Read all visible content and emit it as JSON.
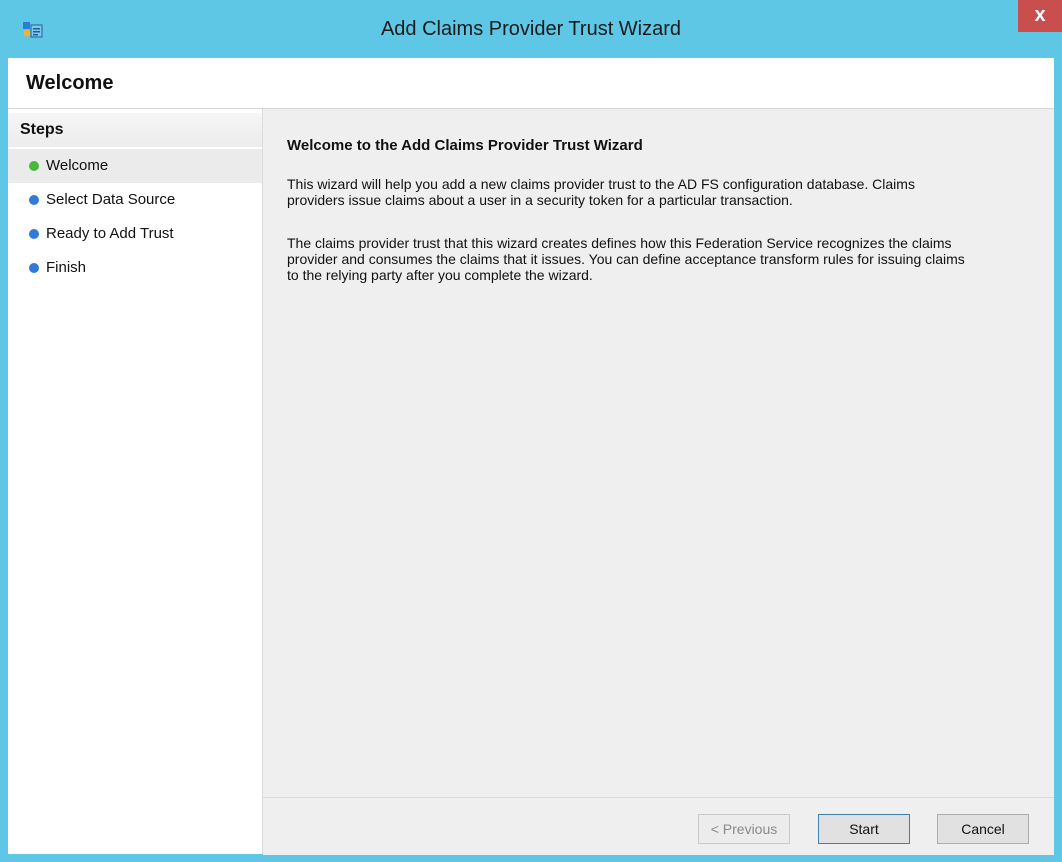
{
  "window": {
    "title": "Add Claims Provider Trust Wizard",
    "close_label": "x",
    "app_icon": "adfs-wizard-icon",
    "title_bar_color": "#5ec7e6",
    "close_button_color": "#c94f4f"
  },
  "header": {
    "page_title": "Welcome"
  },
  "steps": {
    "heading": "Steps",
    "items": [
      {
        "label": "Welcome",
        "status_color": "#45b93c",
        "active": true
      },
      {
        "label": "Select Data Source",
        "status_color": "#2f7bd8",
        "active": false
      },
      {
        "label": "Ready to Add Trust",
        "status_color": "#2f7bd8",
        "active": false
      },
      {
        "label": "Finish",
        "status_color": "#2f7bd8",
        "active": false
      }
    ]
  },
  "content": {
    "heading": "Welcome to the Add Claims Provider Trust Wizard",
    "paragraph1_line1": "This wizard will help you add a new claims provider trust to the AD FS configuration database. Claims",
    "paragraph1_line2": "providers issue claims about a user in a security token for a particular transaction.",
    "paragraph2_line1": "The claims provider trust that this wizard creates defines how this Federation Service recognizes the claims",
    "paragraph2_line2": "provider and consumes the claims that it issues. You can define acceptance transform rules for issuing claims",
    "paragraph2_line3": "to the relying party after you complete the wizard."
  },
  "footer": {
    "previous_label": "< Previous",
    "start_label": "Start",
    "cancel_label": "Cancel"
  }
}
